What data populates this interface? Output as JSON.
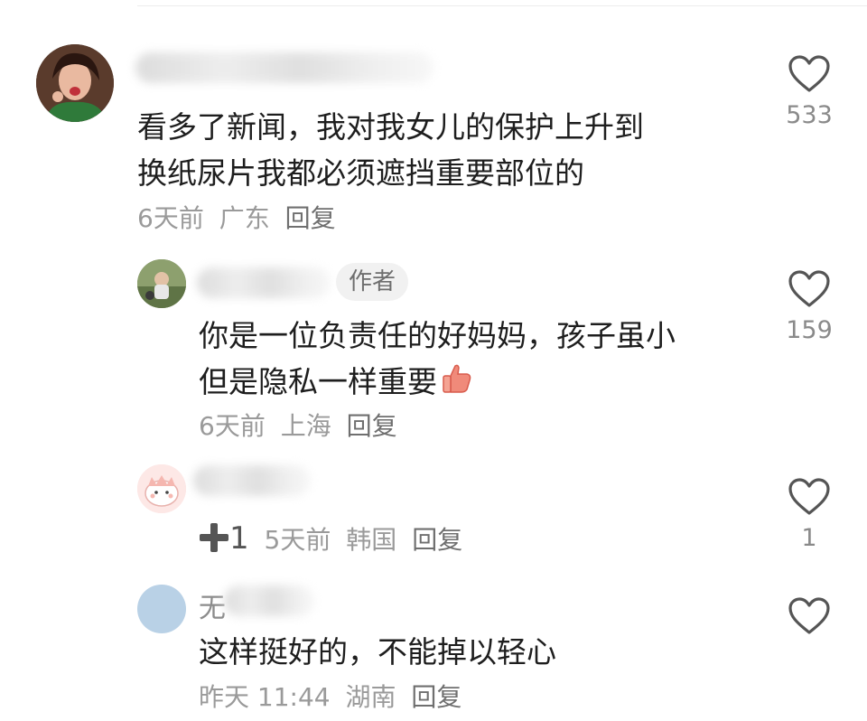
{
  "comments": [
    {
      "name_visible": "",
      "text_lines": [
        "看多了新闻，我对我女儿的保护上升到",
        "换纸尿片我都必须遮挡重要部位的"
      ],
      "time": "6天前",
      "location": "广东",
      "reply_label": "回复",
      "likes": "533"
    },
    {
      "author_badge": "作者",
      "text_lines": [
        "你是一位负责任的好妈妈，孩子虽小",
        "但是隐私一样重要"
      ],
      "emoji": "thumbs-up-emoji",
      "time": "6天前",
      "location": "上海",
      "reply_label": "回复",
      "likes": "159"
    },
    {
      "plus_one": "1",
      "time": "5天前",
      "location": "韩国",
      "reply_label": "回复",
      "likes": "1"
    },
    {
      "name_prefix": "无",
      "text_lines": [
        "这样挺好的，不能掉以轻心"
      ],
      "time": "昨天 11:44",
      "location": "湖南",
      "reply_label": "回复"
    }
  ],
  "colors": {
    "text": "#1e1e1e",
    "meta": "#9a9a9a",
    "icon": "#555555"
  }
}
